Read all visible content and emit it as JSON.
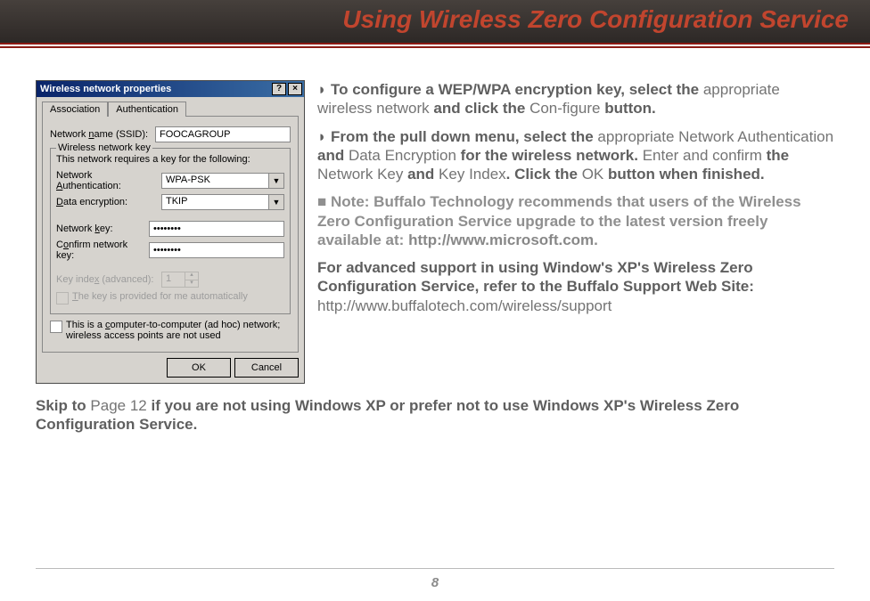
{
  "header": {
    "title": "Using Wireless Zero Configuration Service"
  },
  "dialog": {
    "title": "Wireless network properties",
    "help": "?",
    "close": "×",
    "tabs": {
      "assoc": "Association",
      "auth": "Authentication"
    },
    "ssid_label": "Network name (SSID):",
    "ssid_value": "FOOCAGROUP",
    "group_label": "Wireless network key",
    "requires": "This network requires a key for the following:",
    "netauth_label": "Network Authentication:",
    "netauth_value": "WPA-PSK",
    "dataenc_label": "Data encryption:",
    "dataenc_value": "TKIP",
    "netkey_label": "Network key:",
    "netkey_value": "••••••••",
    "confirm_label": "Confirm network key:",
    "confirm_value": "••••••••",
    "keyidx_label": "Key index (advanced):",
    "keyidx_value": "1",
    "auto_label": "The key is provided for me automatically",
    "adhoc_label": "This is a computer-to-computer (ad hoc) network; wireless access points are not used",
    "ok": "OK",
    "cancel": "Cancel"
  },
  "para1": {
    "a": "To configure a WEP/WPA encryption key, select the ",
    "b": "appropriate wireless network ",
    "c": "and click the ",
    "d": "Con-figure ",
    "e": "button."
  },
  "para2": {
    "a": "From the pull down menu, select the ",
    "b": "appropriate Network Authentication ",
    "c": "and ",
    "d": "Data Encryption ",
    "e": "for the wireless network.  ",
    "f": "Enter and confirm ",
    "g": "the ",
    "h": "Network Key ",
    "i": "and ",
    "j": "Key Index",
    "k": ".  Click the ",
    "l": "OK ",
    "m": "button when finished."
  },
  "note": {
    "a": "Note: Buffalo Technology recommends that users of the Wireless Zero Configuration Service upgrade to the latest version freely available at: ",
    "b": "http://www.microsoft.com",
    "c": "."
  },
  "para3": {
    "a": "For advanced support in using Window's XP's Wireless Zero Configuration Service, refer to the Buffalo Support Web Site: ",
    "b": "http://www.buffalotech.com/wireless/support"
  },
  "skip": {
    "a": "Skip to ",
    "b": "Page 12 ",
    "c": "if you are not using Windows XP or prefer not to use Windows XP's Wireless Zero Configuration Service."
  },
  "page_num": "8"
}
